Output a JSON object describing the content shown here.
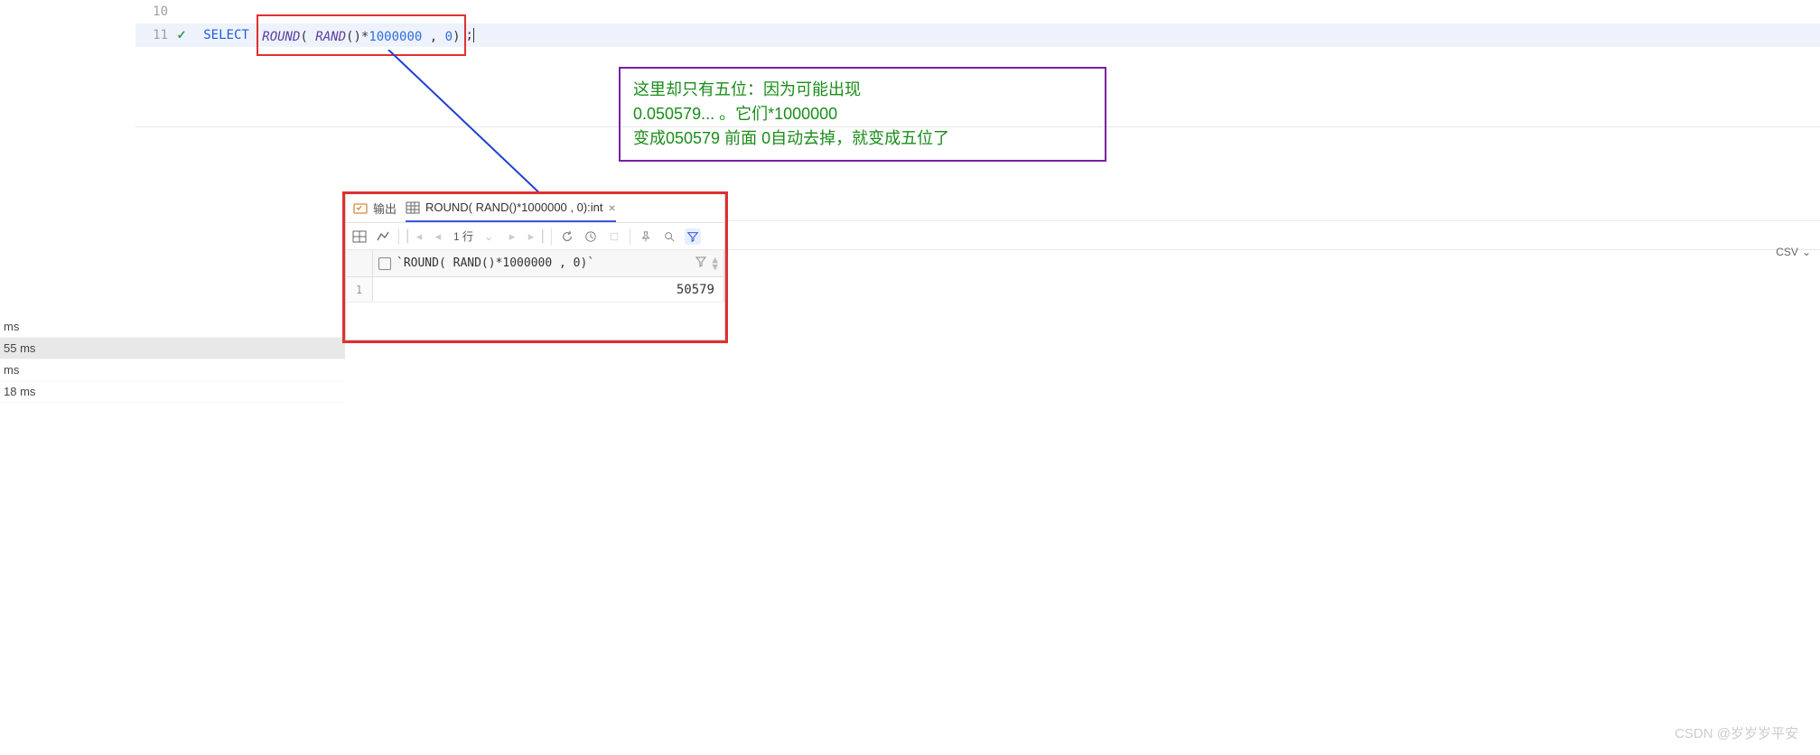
{
  "editor": {
    "lines": {
      "l10_num": "10",
      "l11_num": "11",
      "l11_select": "SELECT",
      "l11_round": "ROUND",
      "l11_rand": "RAND",
      "l11_mul_num": "1000000",
      "l11_arg2": "0",
      "l11_open1": "(",
      "l11_open2": "(",
      "l11_close2": ")",
      "l11_star": "*",
      "l11_comma": " ,",
      "l11_close1": ")",
      "l11_semi": ";"
    }
  },
  "annotation": {
    "line1": "这里却只有五位：因为可能出现",
    "line2": "0.050579... 。它们*1000000",
    "line3": "变成050579 前面 0自动去掉，就变成五位了"
  },
  "results": {
    "tab_output": "输出",
    "tab_result": "ROUND( RAND()*1000000 , 0):int",
    "rows_label": "1 行",
    "col_header": "`ROUND( RAND()*1000000 , 0)`",
    "row1_num": "1",
    "row1_val": "50579",
    "csv": "CSV"
  },
  "side": {
    "r1": "ms",
    "r2": "55 ms",
    "r3": "ms",
    "r4": "18 ms"
  },
  "watermark": "CSDN @岁岁岁平安"
}
